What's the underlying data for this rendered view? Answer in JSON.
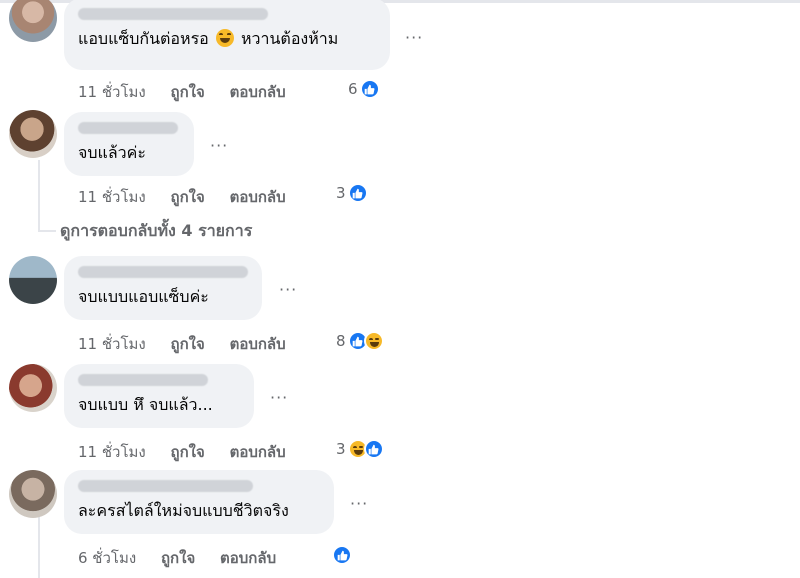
{
  "comments": [
    {
      "text_before_emoji": "แอบแซ็บกันต่อหรอ",
      "emoji": "laughing-tears-emoji",
      "text_after_emoji": "หวานต้องห้าม",
      "time": "11 ชั่วโมง",
      "like": "ถูกใจ",
      "reply": "ตอบกลับ",
      "reaction_count": "6",
      "reactions": [
        "like"
      ]
    },
    {
      "text": "จบแล้วค่ะ",
      "time": "11 ชั่วโมง",
      "like": "ถูกใจ",
      "reply": "ตอบกลับ",
      "reaction_count": "3",
      "reactions": [
        "like"
      ]
    },
    {
      "text": "จบแบบแอบแซ็บค่ะ",
      "time": "11 ชั่วโมง",
      "like": "ถูกใจ",
      "reply": "ตอบกลับ",
      "reaction_count": "8",
      "reactions": [
        "like",
        "haha"
      ]
    },
    {
      "text": "จบแบบ หึ จบแล้ว...",
      "time": "11 ชั่วโมง",
      "like": "ถูกใจ",
      "reply": "ตอบกลับ",
      "reaction_count": "3",
      "reactions": [
        "haha",
        "like"
      ]
    },
    {
      "text": "ละครสไตล์ใหม่จบแบบชีวิตจริง",
      "time": "6 ชั่วโมง",
      "like": "ถูกใจ",
      "reply": "ตอบกลับ",
      "reaction_count": "",
      "reactions": [
        "like"
      ]
    }
  ],
  "view_replies": "ดูการตอบกลับทั้ง 4 รายการ",
  "more_options": "···",
  "colors": {
    "bubble": "#f0f2f5",
    "secondary_text": "#65676b",
    "like_blue": "#1877f2",
    "haha_yellow": "#f7b928"
  }
}
